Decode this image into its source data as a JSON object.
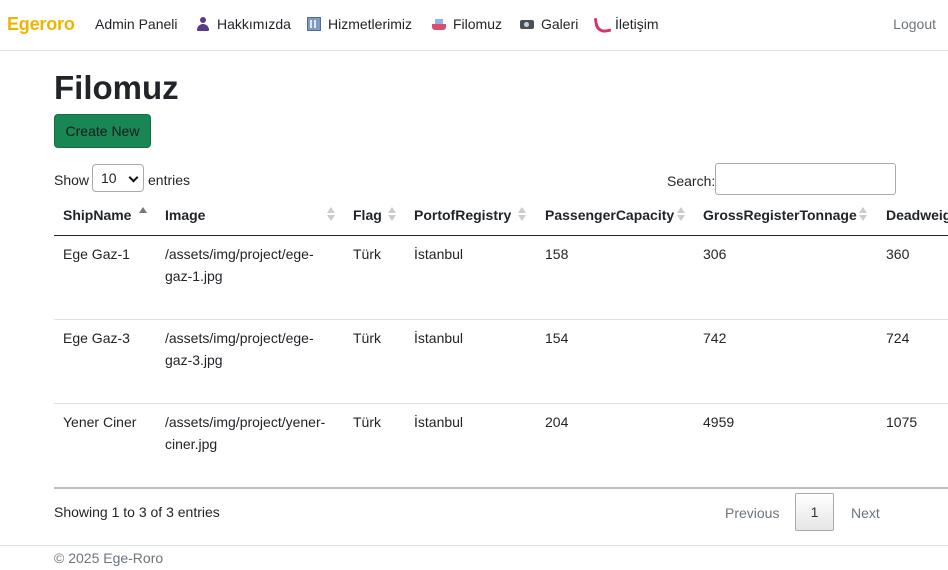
{
  "navbar": {
    "brand": "Egeroro",
    "items": [
      {
        "label": "Admin Paneli",
        "icon": "none"
      },
      {
        "label": "Hakkımızda",
        "icon": "person-icon"
      },
      {
        "label": "Hizmetlerimiz",
        "icon": "building-icon"
      },
      {
        "label": "Filomuz",
        "icon": "ship-icon"
      },
      {
        "label": "Galeri",
        "icon": "camera-icon"
      },
      {
        "label": "İletişim",
        "icon": "phone-icon"
      }
    ],
    "logout": "Logout"
  },
  "page": {
    "title": "Filomuz",
    "create_button": "Create New"
  },
  "length_menu": {
    "show_label": "Show",
    "selected": "10",
    "entries_label": "entries"
  },
  "search": {
    "label": "Search:",
    "value": ""
  },
  "table": {
    "columns": [
      "ShipName",
      "Image",
      "Flag",
      "PortofRegistry",
      "PassengerCapacity",
      "GrossRegisterTonnage",
      "Deadweig"
    ],
    "rows": [
      {
        "ship": "Ege Gaz-1",
        "image_l1": "/assets/img/project/ege-",
        "image_l2": "gaz-1.jpg",
        "flag": "Türk",
        "port": "İstanbul",
        "pax": "158",
        "grt": "306",
        "dwt": "360"
      },
      {
        "ship": "Ege Gaz-3",
        "image_l1": "/assets/img/project/ege-",
        "image_l2": "gaz-3.jpg",
        "flag": "Türk",
        "port": "İstanbul",
        "pax": "154",
        "grt": "742",
        "dwt": "724"
      },
      {
        "ship": "Yener Ciner",
        "image_l1": "/assets/img/project/yener-",
        "image_l2": "ciner.jpg",
        "flag": "Türk",
        "port": "İstanbul",
        "pax": "204",
        "grt": "4959",
        "dwt": "1075"
      }
    ]
  },
  "info": "Showing 1 to 3 of 3 entries",
  "pagination": {
    "previous": "Previous",
    "current": "1",
    "next": "Next"
  },
  "footer": "© 2025 Ege-Roro",
  "colors": {
    "brand": "#f0b400",
    "create_button": "#198754"
  }
}
